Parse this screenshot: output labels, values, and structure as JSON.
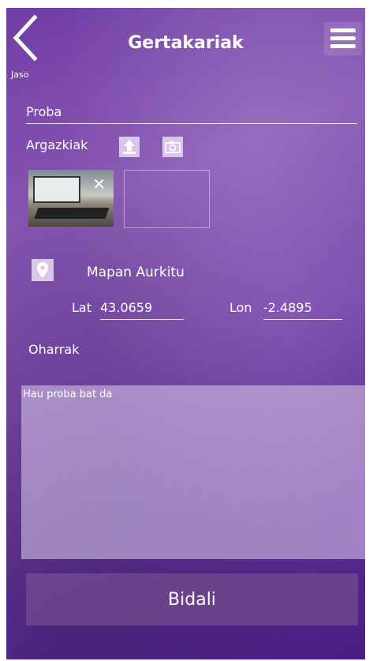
{
  "header": {
    "back_label": "Jaso",
    "title": "Gertakariak"
  },
  "form": {
    "name_value": "Proba",
    "photos_label": "Argazkiak",
    "locate_label": "Mapan Aurkitu",
    "lat_label": "Lat",
    "lat_value": "43.0659",
    "lon_label": "Lon",
    "lon_value": "-2.4895",
    "notes_label": "Oharrak",
    "notes_value": "Hau proba bat da",
    "submit_label": "Bidali"
  },
  "icons": {
    "back": "chevron-left-icon",
    "menu": "hamburger-menu-icon",
    "upload": "upload-icon",
    "camera": "camera-icon",
    "remove": "close-icon",
    "location": "map-pin-icon"
  },
  "colors": {
    "background_top": "#6f3ea4",
    "background_bottom": "#4b1d83",
    "icon_button": "#d9c7ea",
    "submit_button": "#6e488c"
  }
}
